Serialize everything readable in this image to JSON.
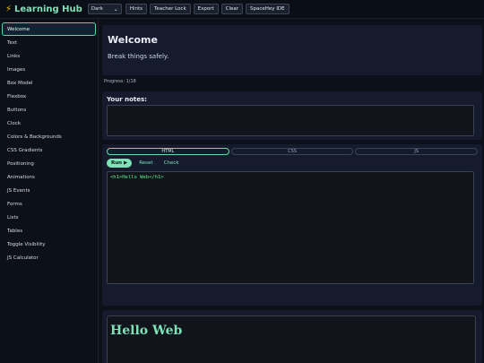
{
  "header": {
    "brand": "Learning Hub",
    "theme_value": "Dark",
    "buttons": [
      "Hints",
      "Teacher Lock",
      "Export",
      "Clear",
      "SpaceHey IDE"
    ]
  },
  "sidebar": {
    "items": [
      "Welcome",
      "Text",
      "Links",
      "Images",
      "Box Model",
      "Flexbox",
      "Buttons",
      "Clock",
      "Colors & Backgrounds",
      "CSS Gradients",
      "Positioning",
      "Animations",
      "JS Events",
      "Forms",
      "Lists",
      "Tables",
      "Toggle Visibility",
      "JS Calculator"
    ],
    "active_index": 0
  },
  "lesson": {
    "title": "Welcome",
    "subtitle": "Break things safely.",
    "progress": "Progress: 1/18"
  },
  "notes": {
    "label": "Your notes:",
    "value": ""
  },
  "editor": {
    "tabs": [
      "HTML",
      "CSS",
      "JS"
    ],
    "active_tab": 0,
    "run_label": "Run ▶",
    "reset_label": "Reset",
    "check_label": "Check",
    "code": "<h1>Hello Web</h1>"
  },
  "preview": {
    "heading": "Hello Web"
  },
  "colors": {
    "accent": "#7ee2b8",
    "panel": "#151b2c",
    "background": "#0c1119",
    "code_text": "#5ef08a"
  }
}
